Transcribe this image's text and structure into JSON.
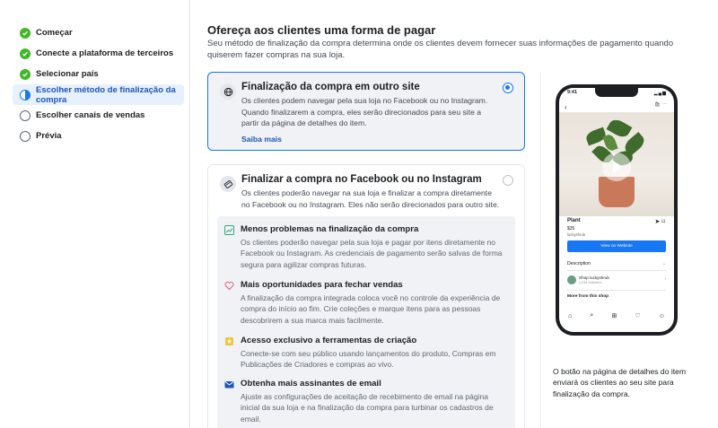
{
  "sidebar": {
    "steps": [
      {
        "label": "Começar",
        "state": "done"
      },
      {
        "label": "Conecte a plataforma de terceiros",
        "state": "done"
      },
      {
        "label": "Selecionar país",
        "state": "done"
      },
      {
        "label": "Escolher método de finalização da compra",
        "state": "current"
      },
      {
        "label": "Escolher canais de vendas",
        "state": "todo"
      },
      {
        "label": "Prévia",
        "state": "todo"
      }
    ]
  },
  "main": {
    "title": "Ofereça aos clientes uma forma de pagar",
    "subtitle": "Seu método de finalização da compra determina onde os clientes devem fornecer suas informações de pagamento quando quiserem fazer compras na sua loja.",
    "options": [
      {
        "title": "Finalização da compra em outro site",
        "text": "Os clientes podem navegar pela sua loja no Facebook ou no Instagram. Quando finalizarem a compra, eles serão direcionados para seu site a partir da página de detalhes do item.",
        "link": "Saiba mais",
        "icon": "globe-icon",
        "selected": true
      },
      {
        "title": "Finalizar a compra no Facebook ou no Instagram",
        "text": "Os clientes poderão navegar na sua loja e finalizar a compra diretamente no Facebook ou no Instagram. Eles não serão direcionados para outro site.",
        "icon": "card-icon",
        "selected": false
      }
    ],
    "benefits": [
      {
        "title": "Menos problemas na finalização da compra",
        "text": "Os clientes poderão navegar pela sua loja e pagar por itens diretamente no Facebook ou Instagram. As credenciais de pagamento serão salvas de forma segura para agilizar compras futuras.",
        "icon": "chart-icon",
        "color": "#3aa57a"
      },
      {
        "title": "Mais oportunidades para fechar vendas",
        "text": "A finalização da compra integrada coloca você no controle da experiência de compra do início ao fim. Crie coleções e marque itens para as pessoas descobrirem a sua marca mais facilmente.",
        "icon": "heart-icon",
        "color": "#e0607e"
      },
      {
        "title": "Acesso exclusivo a ferramentas de criação",
        "text": "Conecte-se com seu público usando lançamentos do produto, Compras em Publicações de Criadores e compras ao vivo.",
        "icon": "star-badge-icon",
        "color": "#f5c33b"
      },
      {
        "title": "Obtenha mais assinantes de email",
        "text": "Ajuste as configurações de aceitação de recebimento de email na página inicial da sua loja e na finalização da compra para turbinar os cadastros de email.",
        "icon": "mail-icon",
        "color": "#1b57b8"
      }
    ]
  },
  "preview": {
    "phone": {
      "time": "9:41",
      "product_name": "Plant",
      "price": "$35",
      "shop_handle": "luckyshrub",
      "button": "View on Website",
      "description": "Description",
      "shop_name": "Shop luckyshrub",
      "followers": "1,234 followers",
      "more": "More from this shop"
    },
    "caption": "O botão na página de detalhes do item enviará os clientes ao seu site para finalização da compra."
  },
  "colors": {
    "accent": "#1877f2",
    "done": "#42b72a",
    "link": "#1b57b8"
  }
}
